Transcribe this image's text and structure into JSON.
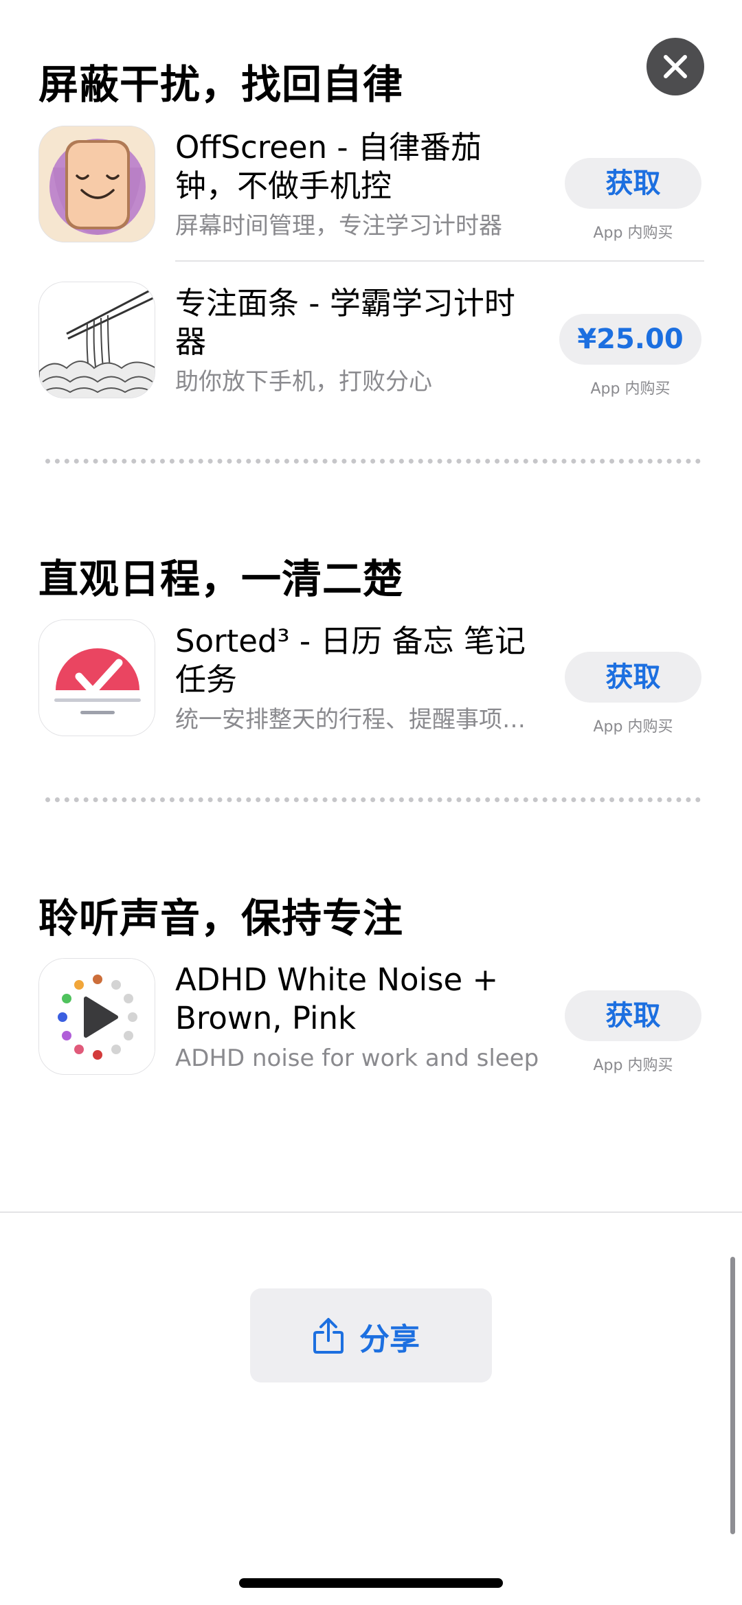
{
  "sections": [
    {
      "title": "屏蔽干扰，找回自律",
      "apps": [
        {
          "name": "OffScreen - 自律番茄钟，不做手机控",
          "subtitle": "屏幕时间管理，专注学习计时器",
          "button": "获取",
          "iap": "App 内购买"
        },
        {
          "name": "专注面条 - 学霸学习计时器",
          "subtitle": "助你放下手机，打败分心",
          "button": "¥25.00",
          "iap": "App 内购买"
        }
      ]
    },
    {
      "title": "直观日程，一清二楚",
      "apps": [
        {
          "name": "Sorted³ - 日历 备忘 笔记 任务",
          "subtitle": "统一安排整天的行程、提醒事项和笔记",
          "button": "获取",
          "iap": "App 内购买"
        }
      ]
    },
    {
      "title": "聆听声音，保持专注",
      "apps": [
        {
          "name": "ADHD White Noise + Brown, Pink",
          "subtitle": "ADHD noise for work and sleep",
          "button": "获取",
          "iap": "App 内购买"
        }
      ]
    }
  ],
  "share": {
    "label": "分享"
  },
  "icons": {
    "close": "close-icon",
    "share": "share-icon",
    "offscreen": "offscreen-app-icon",
    "noodles": "noodles-app-icon",
    "sorted": "sorted-app-icon",
    "adhd": "white-noise-app-icon"
  },
  "colors": {
    "accent": "#1c6fe0",
    "button_bg": "#eeeef0",
    "secondary_text": "#8a8a8e"
  }
}
